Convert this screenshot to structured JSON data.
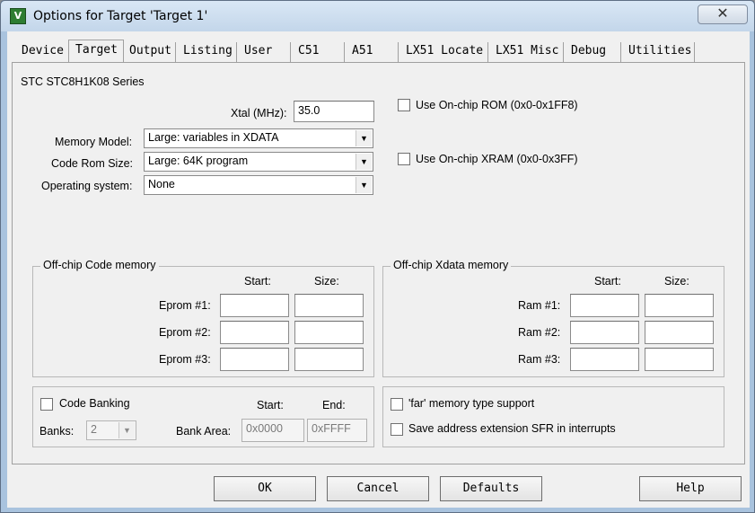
{
  "window": {
    "title": "Options for Target 'Target 1'",
    "close_glyph": "✕",
    "app_icon_glyph": "V"
  },
  "tabs": [
    {
      "label": "Device"
    },
    {
      "label": "Target",
      "active": true
    },
    {
      "label": "Output"
    },
    {
      "label": "Listing"
    },
    {
      "label": "User"
    },
    {
      "label": "C51"
    },
    {
      "label": "A51"
    },
    {
      "label": "LX51 Locate"
    },
    {
      "label": "LX51 Misc"
    },
    {
      "label": "Debug"
    },
    {
      "label": "Utilities"
    }
  ],
  "target": {
    "device_name": "STC STC8H1K08 Series",
    "xtal_label": "Xtal (MHz):",
    "xtal_value": "35.0",
    "memory_model_label": "Memory Model:",
    "memory_model_value": "Large: variables in XDATA",
    "code_rom_label": "Code Rom Size:",
    "code_rom_value": "Large: 64K program",
    "os_label": "Operating system:",
    "os_value": "None",
    "onchip_rom_label": "Use On-chip ROM (0x0-0x1FF8)",
    "onchip_xram_label": "Use On-chip XRAM (0x0-0x3FF)"
  },
  "code_memory": {
    "title": "Off-chip Code memory",
    "start_header": "Start:",
    "size_header": "Size:",
    "rows": [
      {
        "label": "Eprom #1:"
      },
      {
        "label": "Eprom #2:"
      },
      {
        "label": "Eprom #3:"
      }
    ]
  },
  "xdata_memory": {
    "title": "Off-chip Xdata memory",
    "start_header": "Start:",
    "size_header": "Size:",
    "rows": [
      {
        "label": "Ram #1:"
      },
      {
        "label": "Ram #2:"
      },
      {
        "label": "Ram #3:"
      }
    ]
  },
  "banking": {
    "code_banking_label": "Code Banking",
    "start_header": "Start:",
    "end_header": "End:",
    "banks_label": "Banks:",
    "banks_value": "2",
    "bank_area_label": "Bank Area:",
    "bank_area_start": "0x0000",
    "bank_area_end": "0xFFFF"
  },
  "options": {
    "far_memory_label": "'far' memory type support",
    "save_sfr_label": "Save address extension SFR in interrupts"
  },
  "buttons": {
    "ok": "OK",
    "cancel": "Cancel",
    "defaults": "Defaults",
    "help": "Help"
  }
}
